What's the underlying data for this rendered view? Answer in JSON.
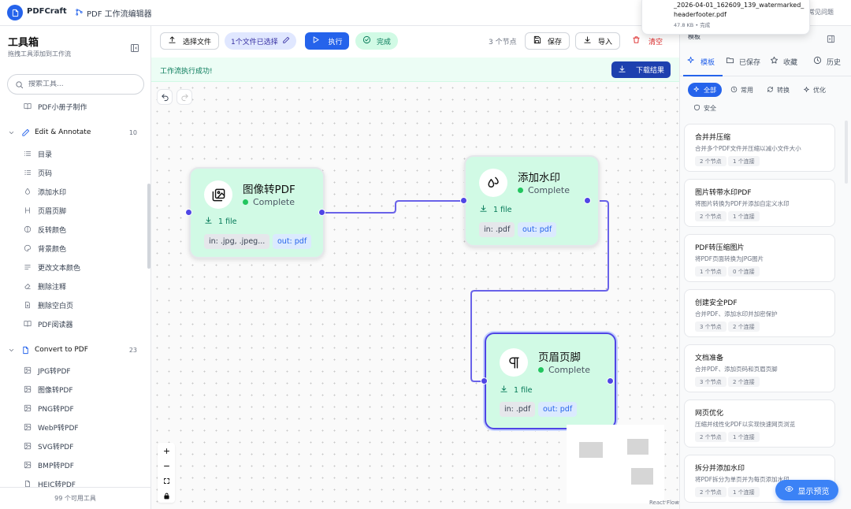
{
  "topbar": {
    "app_name": "PDFCraft",
    "breadcrumb": "PDF 工作流编辑器",
    "help_text": "常见问题"
  },
  "download_popup": {
    "filename": "_2026-04-01_162609_139_watermarked_headerfooter.pdf",
    "meta": "47.8 KB • 完成"
  },
  "sidebar": {
    "title": "工具箱",
    "subtitle": "拖拽工具添加到工作流",
    "search_placeholder": "搜索工具...",
    "footer": "99 个可用工具",
    "top_item": {
      "label": "PDF小册子制作",
      "icon": "book-icon"
    },
    "categories": [
      {
        "label": "Edit & Annotate",
        "count": "10",
        "icon": "pencil-icon",
        "items": [
          {
            "label": "目录",
            "icon": "list-icon"
          },
          {
            "label": "页码",
            "icon": "numbered-list-icon"
          },
          {
            "label": "添加水印",
            "icon": "droplet-icon"
          },
          {
            "label": "页眉页脚",
            "icon": "header-icon"
          },
          {
            "label": "反转颜色",
            "icon": "contrast-icon"
          },
          {
            "label": "背景颜色",
            "icon": "palette-icon"
          },
          {
            "label": "更改文本颜色",
            "icon": "text-lines-icon"
          },
          {
            "label": "删除注释",
            "icon": "eraser-icon"
          },
          {
            "label": "删除空白页",
            "icon": "file-x-icon"
          },
          {
            "label": "PDF阅读器",
            "icon": "book-open-icon"
          }
        ]
      },
      {
        "label": "Convert to PDF",
        "count": "23",
        "icon": "file-convert-icon",
        "items": [
          {
            "label": "JPG转PDF",
            "icon": "image-icon"
          },
          {
            "label": "图像转PDF",
            "icon": "images-icon"
          },
          {
            "label": "PNG转PDF",
            "icon": "image-icon"
          },
          {
            "label": "WebP转PDF",
            "icon": "image-icon"
          },
          {
            "label": "SVG转PDF",
            "icon": "image-icon"
          },
          {
            "label": "BMP转PDF",
            "icon": "image-icon"
          },
          {
            "label": "HEIC转PDF",
            "icon": "file-icon"
          }
        ]
      }
    ]
  },
  "toolbar": {
    "select_file": "选择文件",
    "file_selected": "1个文件已选择",
    "run": "执行",
    "status": "完成",
    "node_count": "3 个节点",
    "save": "保存",
    "import": "导入",
    "clear": "清空"
  },
  "banner": {
    "message": "工作流执行成功!",
    "download": "下载结果"
  },
  "nodes": [
    {
      "title": "图像转PDF",
      "status": "Complete",
      "files": "1 file",
      "input": "in: .jpg, .jpeg...",
      "output": "out: pdf",
      "icon": "images-icon"
    },
    {
      "title": "添加水印",
      "status": "Complete",
      "files": "1 file",
      "input": "in: .pdf",
      "output": "out: pdf",
      "icon": "droplets-icon"
    },
    {
      "title": "页眉页脚",
      "status": "Complete",
      "files": "1 file",
      "input": "in: .pdf",
      "output": "out: pdf",
      "icon": "pilcrow-icon"
    }
  ],
  "canvas": {
    "attribution": "React Flow"
  },
  "right_panel": {
    "header": "模板",
    "tabs": [
      {
        "label": "模板",
        "icon": "sparkles-icon",
        "active": true
      },
      {
        "label": "已保存",
        "icon": "folder-icon",
        "active": false
      },
      {
        "label": "收藏",
        "icon": "star-icon",
        "active": false
      },
      {
        "label": "历史",
        "icon": "clock-icon",
        "active": false
      }
    ],
    "filters": [
      {
        "label": "全部",
        "icon": "sparkles-icon",
        "active": true
      },
      {
        "label": "常用",
        "icon": "clock-icon",
        "active": false
      },
      {
        "label": "转换",
        "icon": "refresh-icon",
        "active": false
      },
      {
        "label": "优化",
        "icon": "sparkle-icon",
        "active": false
      },
      {
        "label": "安全",
        "icon": "shield-icon",
        "active": false
      }
    ],
    "templates": [
      {
        "title": "合并并压缩",
        "desc": "合并多个PDF文件并压缩以减小文件大小",
        "nodes": "2 个节点",
        "links": "1 个连接"
      },
      {
        "title": "图片转带水印PDF",
        "desc": "将图片转换为PDF并添加自定义水印",
        "nodes": "2 个节点",
        "links": "1 个连接"
      },
      {
        "title": "PDF转压缩图片",
        "desc": "将PDF页面转换为JPG图片",
        "nodes": "1 个节点",
        "links": "0 个连接"
      },
      {
        "title": "创建安全PDF",
        "desc": "合并PDF、添加水印并加密保护",
        "nodes": "3 个节点",
        "links": "2 个连接"
      },
      {
        "title": "文档准备",
        "desc": "合并PDF、添加页码和页眉页脚",
        "nodes": "3 个节点",
        "links": "2 个连接"
      },
      {
        "title": "网页优化",
        "desc": "压缩并线性化PDF以实现快速网页浏览",
        "nodes": "2 个节点",
        "links": "1 个连接"
      },
      {
        "title": "拆分并添加水印",
        "desc": "将PDF拆分为单页并为每页添加水印",
        "nodes": "2 个节点",
        "links": "1 个连接"
      }
    ],
    "preview_button": "显示预览"
  },
  "colors": {
    "accent": "#2563eb",
    "node_bg": "#d1fae5",
    "success": "#22c55e",
    "edge": "#4f46e5",
    "danger": "#dc2626"
  }
}
